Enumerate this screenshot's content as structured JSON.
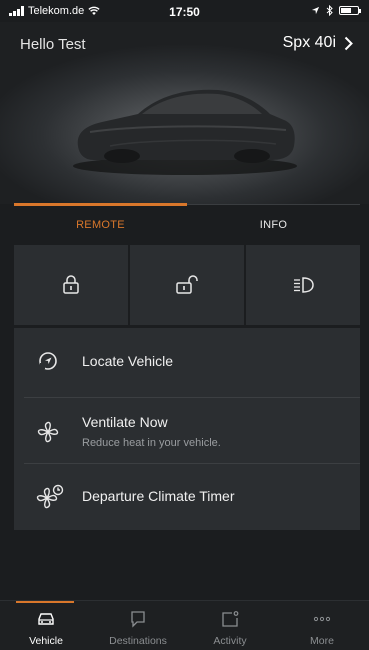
{
  "status_bar": {
    "carrier": "Telekom.de",
    "time": "17:50"
  },
  "header": {
    "greeting": "Hello Test",
    "vehicle_name": "Spx 40i"
  },
  "tabs": [
    {
      "label": "REMOTE",
      "active": true
    },
    {
      "label": "INFO",
      "active": false
    }
  ],
  "quick_actions": [
    {
      "icon": "lock-icon"
    },
    {
      "icon": "unlock-icon"
    },
    {
      "icon": "headlight-flash-icon"
    }
  ],
  "actions": [
    {
      "icon": "locate-icon",
      "label": "Locate Vehicle"
    },
    {
      "icon": "fan-icon",
      "label": "Ventilate Now",
      "subtitle": "Reduce heat in your vehicle."
    },
    {
      "icon": "climate-timer-icon",
      "label": "Departure Climate Timer"
    }
  ],
  "bottom_nav": [
    {
      "icon": "car-icon",
      "label": "Vehicle",
      "active": true
    },
    {
      "icon": "destinations-icon",
      "label": "Destinations",
      "active": false
    },
    {
      "icon": "activity-icon",
      "label": "Activity",
      "active": false
    },
    {
      "icon": "more-icon",
      "label": "More",
      "active": false
    }
  ],
  "colors": {
    "accent": "#d9772b",
    "background": "#1b1d1f",
    "panel": "#2b2e31"
  }
}
